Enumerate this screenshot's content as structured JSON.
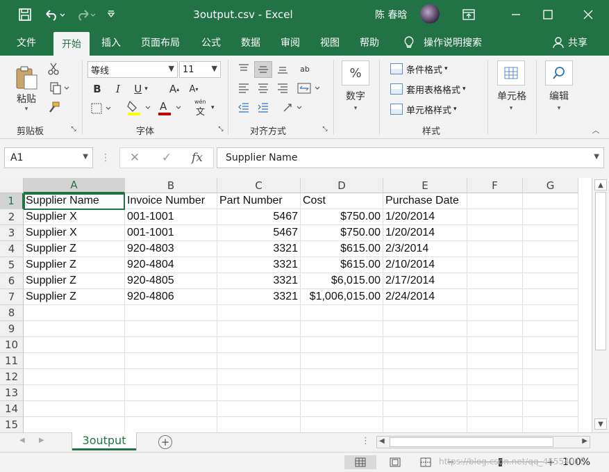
{
  "window": {
    "title": "3output.csv  -  Excel",
    "user_name": "陈 春晗",
    "colors": {
      "accent": "#217346",
      "ribbon_bg": "#f3f3f3",
      "font_red": "#c00000",
      "highlight_yellow": "#ffff00"
    }
  },
  "tabs": [
    "文件",
    "开始",
    "插入",
    "页面布局",
    "公式",
    "数据",
    "审阅",
    "视图",
    "帮助",
    "操作说明搜索",
    "共享"
  ],
  "active_tab": "开始",
  "ribbon": {
    "clipboard": {
      "paste_label": "粘贴",
      "group_label": "剪贴板"
    },
    "font": {
      "font_name": "等线",
      "font_size": "11",
      "group_label": "字体",
      "phonetic_label": "wén"
    },
    "alignment": {
      "group_label": "对齐方式"
    },
    "number": {
      "label": "数字",
      "icon_label": "%"
    },
    "styles": {
      "items": [
        "条件格式",
        "套用表格格式",
        "单元格样式"
      ],
      "group_label": "样式"
    },
    "cells": {
      "label": "单元格"
    },
    "editing": {
      "label": "编辑"
    }
  },
  "formula_bar": {
    "name_box": "A1",
    "content": "Supplier Name",
    "fx_label": "fx"
  },
  "grid": {
    "columns": [
      "A",
      "B",
      "C",
      "D",
      "E",
      "F",
      "G"
    ],
    "rows": [
      "1",
      "2",
      "3",
      "4",
      "5",
      "6",
      "7",
      "8",
      "9",
      "10",
      "11",
      "12",
      "13",
      "14",
      "15"
    ],
    "active_cell": "A1",
    "header": [
      "Supplier Name",
      "Invoice Number",
      "Part Number",
      "Cost",
      "Purchase Date"
    ],
    "data": [
      [
        "Supplier X",
        "001-1001",
        "5467",
        "$750.00",
        "1/20/2014"
      ],
      [
        "Supplier X",
        "001-1001",
        "5467",
        "$750.00",
        "1/20/2014"
      ],
      [
        "Supplier Z",
        "920-4803",
        "3321",
        "$615.00",
        "2/3/2014"
      ],
      [
        "Supplier Z",
        "920-4804",
        "3321",
        "$615.00",
        "2/10/2014"
      ],
      [
        "Supplier Z",
        "920-4805",
        "3321",
        "$6,015.00",
        "2/17/2014"
      ],
      [
        "Supplier Z",
        "920-4806",
        "3321",
        "$1,006,015.00",
        "2/24/2014"
      ]
    ]
  },
  "sheet_tab": "3output",
  "status": {
    "zoom": "100%",
    "watermark": "https://blog.csdn.net/qq_45554010"
  }
}
